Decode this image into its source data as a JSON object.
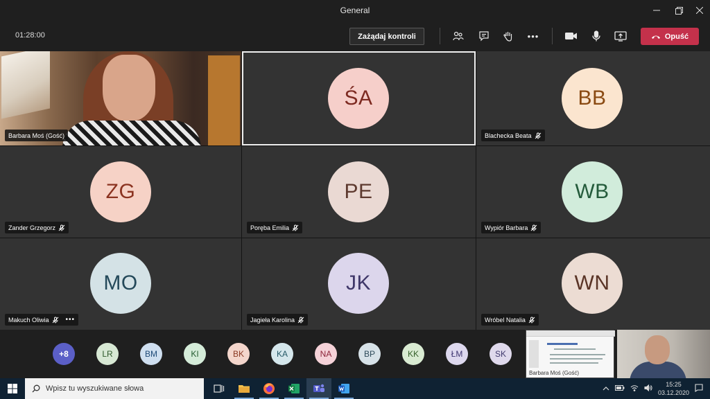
{
  "window": {
    "title": "General"
  },
  "toolbar": {
    "timer": "01:28:00",
    "request_control_label": "Zażądaj kontroli",
    "leave_label": "Opuść",
    "more_label": "•••"
  },
  "tiles": [
    {
      "name": "Barbara Moś (Gość)",
      "type": "video",
      "muted": false
    },
    {
      "initials": "ŚA",
      "name": "",
      "bg": "#f6cfca",
      "fg": "#7d2a21",
      "active": true
    },
    {
      "initials": "BB",
      "name": "Blachecka Beata",
      "bg": "#fbe5cf",
      "fg": "#8a4a12"
    },
    {
      "initials": "ZG",
      "name": "Zander Grzegorz",
      "bg": "#f6d2c6",
      "fg": "#8b3320"
    },
    {
      "initials": "PE",
      "name": "Poręba Emilia",
      "bg": "#ead9d3",
      "fg": "#5e3a2f"
    },
    {
      "initials": "WB",
      "name": "Wypiór Barbara",
      "bg": "#d1ecdb",
      "fg": "#245b3b"
    },
    {
      "initials": "MO",
      "name": "Makuch Oliwia",
      "bg": "#d4e2e6",
      "fg": "#24495a",
      "more": "•••"
    },
    {
      "initials": "JK",
      "name": "Jagieła Karolina",
      "bg": "#dcd6ec",
      "fg": "#3f3769"
    },
    {
      "initials": "WN",
      "name": "Wróbel Natalia",
      "bg": "#ecdcd3",
      "fg": "#5a3426"
    }
  ],
  "strip": {
    "overflow": "+8",
    "avatars": [
      {
        "initials": "LR",
        "bg": "#d7e8d4",
        "fg": "#2f5a2b"
      },
      {
        "initials": "BM",
        "bg": "#cfdff0",
        "fg": "#1e4a78"
      },
      {
        "initials": "KI",
        "bg": "#d5ecd9",
        "fg": "#245b30"
      },
      {
        "initials": "BK",
        "bg": "#f4d6cc",
        "fg": "#8b3a24"
      },
      {
        "initials": "KA",
        "bg": "#d5e7ec",
        "fg": "#245866"
      },
      {
        "initials": "NA",
        "bg": "#f5d2d8",
        "fg": "#8b2438"
      },
      {
        "initials": "BP",
        "bg": "#d7e2e8",
        "fg": "#2e4b5a"
      },
      {
        "initials": "KK",
        "bg": "#d9ebd2",
        "fg": "#35602a"
      },
      {
        "initials": "ŁM",
        "bg": "#ddd8ee",
        "fg": "#3d3570"
      },
      {
        "initials": "SK",
        "bg": "#dfd9ec",
        "fg": "#413a6e"
      }
    ],
    "share_label": "Barbara Moś (Gość)"
  },
  "taskbar": {
    "search_placeholder": "Wpisz tu wyszukiwane słowa",
    "time": "15:25",
    "date": "03.12.2020"
  }
}
